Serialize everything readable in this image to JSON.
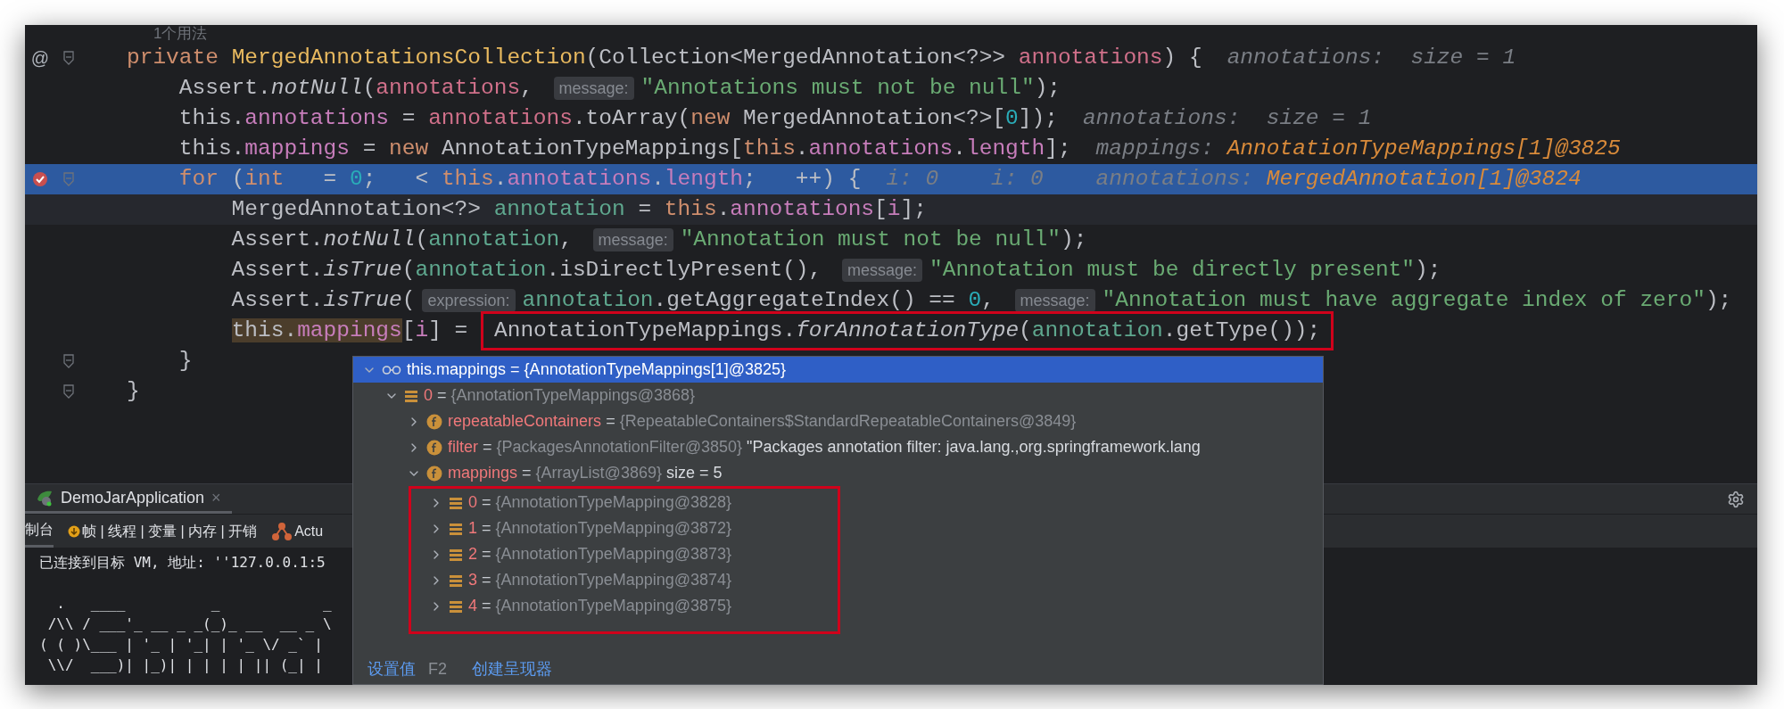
{
  "editor": {
    "lines": [
      {
        "kind": "usage",
        "text": "1个用法"
      },
      {
        "kind": "code",
        "marker": "@",
        "breakpoint": false,
        "fold": true,
        "tokens": [
          {
            "kind": "kw",
            "text": "private "
          },
          {
            "kind": "decl",
            "text": "MergedAnnotationsCollection"
          },
          {
            "kind": "plain",
            "text": "(Collection<MergedAnnotation<?>> "
          },
          {
            "kind": "param",
            "text": "annotations"
          },
          {
            "kind": "plain",
            "text": ") {"
          },
          {
            "kind": "value",
            "text": "annotations:  size = 1"
          }
        ]
      },
      {
        "kind": "code",
        "breakpoint": false,
        "fold": false,
        "tokens": [
          {
            "kind": "plain",
            "text": "    Assert."
          },
          {
            "kind": "italic",
            "text": "notNull"
          },
          {
            "kind": "plain",
            "text": "("
          },
          {
            "kind": "param",
            "text": "annotations"
          },
          {
            "kind": "plain",
            "text": ", "
          },
          {
            "kind": "hint",
            "text": "message:"
          },
          {
            "kind": "string",
            "text": "\"Annotations must not be null\""
          },
          {
            "kind": "plain",
            "text": ");"
          }
        ]
      },
      {
        "kind": "code",
        "breakpoint": false,
        "fold": false,
        "tokens": [
          {
            "kind": "plain",
            "text": "    this."
          },
          {
            "kind": "field",
            "text": "annotations"
          },
          {
            "kind": "plain",
            "text": " = "
          },
          {
            "kind": "param",
            "text": "annotations"
          },
          {
            "kind": "plain",
            "text": ".toArray("
          },
          {
            "kind": "kw",
            "text": "new "
          },
          {
            "kind": "plain",
            "text": "MergedAnnotation<?>["
          },
          {
            "kind": "num",
            "text": "0"
          },
          {
            "kind": "plain",
            "text": "]);"
          },
          {
            "kind": "value",
            "text": "annotations:  size = 1"
          }
        ]
      },
      {
        "kind": "code",
        "breakpoint": false,
        "fold": false,
        "tokens": [
          {
            "kind": "plain",
            "text": "    this."
          },
          {
            "kind": "field",
            "text": "mappings"
          },
          {
            "kind": "plain",
            "text": " = "
          },
          {
            "kind": "kw",
            "text": "new "
          },
          {
            "kind": "plain",
            "text": "AnnotationTypeMappings["
          },
          {
            "kind": "kw",
            "text": "this"
          },
          {
            "kind": "plain",
            "text": "."
          },
          {
            "kind": "field",
            "text": "annotations"
          },
          {
            "kind": "plain",
            "text": "."
          },
          {
            "kind": "field",
            "text": "length"
          },
          {
            "kind": "plain",
            "text": "];"
          },
          {
            "kind": "value",
            "text": "mappings: "
          },
          {
            "kind": "ref",
            "text": "AnnotationTypeMappings[1]@3825"
          }
        ]
      },
      {
        "kind": "current",
        "breakpoint": true,
        "fold": true,
        "tokens": [
          {
            "kind": "kw",
            "text": "    for "
          },
          {
            "kind": "plain",
            "text": "("
          },
          {
            "kind": "kw",
            "text": "int "
          },
          {
            "kind": "plain",
            "text": "  = "
          },
          {
            "kind": "num",
            "text": "0"
          },
          {
            "kind": "plain",
            "text": ";   < "
          },
          {
            "kind": "kw",
            "text": "this"
          },
          {
            "kind": "plain",
            "text": "."
          },
          {
            "kind": "field",
            "text": "annotations"
          },
          {
            "kind": "plain",
            "text": "."
          },
          {
            "kind": "field",
            "text": "length"
          },
          {
            "kind": "plain",
            "text": ";   ++) {"
          },
          {
            "kind": "value",
            "text": "i: 0    i: 0    annotations: "
          },
          {
            "kind": "ref",
            "text": "MergedAnnotation[1]@3824"
          }
        ]
      },
      {
        "kind": "caret",
        "breakpoint": false,
        "fold": false,
        "tokens": [
          {
            "kind": "plain",
            "text": "        MergedAnnotation<?> "
          },
          {
            "kind": "local",
            "text": "annotation"
          },
          {
            "kind": "plain",
            "text": " = "
          },
          {
            "kind": "kw",
            "text": "this"
          },
          {
            "kind": "plain",
            "text": "."
          },
          {
            "kind": "field",
            "text": "annotations"
          },
          {
            "kind": "plain",
            "text": "["
          },
          {
            "kind": "field",
            "text": "i"
          },
          {
            "kind": "plain",
            "text": "];"
          }
        ]
      },
      {
        "kind": "code",
        "breakpoint": false,
        "fold": false,
        "tokens": [
          {
            "kind": "plain",
            "text": "        Assert."
          },
          {
            "kind": "italic",
            "text": "notNull"
          },
          {
            "kind": "plain",
            "text": "("
          },
          {
            "kind": "local",
            "text": "annotation"
          },
          {
            "kind": "plain",
            "text": ", "
          },
          {
            "kind": "hint",
            "text": "message:"
          },
          {
            "kind": "string",
            "text": "\"Annotation must not be null\""
          },
          {
            "kind": "plain",
            "text": ");"
          }
        ]
      },
      {
        "kind": "code",
        "breakpoint": false,
        "fold": false,
        "tokens": [
          {
            "kind": "plain",
            "text": "        Assert."
          },
          {
            "kind": "italic",
            "text": "isTrue"
          },
          {
            "kind": "plain",
            "text": "("
          },
          {
            "kind": "local",
            "text": "annotation"
          },
          {
            "kind": "plain",
            "text": ".isDirectlyPresent(), "
          },
          {
            "kind": "hint",
            "text": "message:"
          },
          {
            "kind": "string",
            "text": "\"Annotation must be directly present\""
          },
          {
            "kind": "plain",
            "text": ");"
          }
        ]
      },
      {
        "kind": "code",
        "breakpoint": false,
        "fold": false,
        "tokens": [
          {
            "kind": "plain",
            "text": "        Assert."
          },
          {
            "kind": "italic",
            "text": "isTrue"
          },
          {
            "kind": "plain",
            "text": "("
          },
          {
            "kind": "hint",
            "text": "expression:"
          },
          {
            "kind": "local",
            "text": "annotation"
          },
          {
            "kind": "plain",
            "text": ".getAggregateIndex() == "
          },
          {
            "kind": "num",
            "text": "0"
          },
          {
            "kind": "plain",
            "text": ", "
          },
          {
            "kind": "hint",
            "text": "message:"
          },
          {
            "kind": "string",
            "text": "\"Annotation must have aggregate index of zero\""
          },
          {
            "kind": "plain",
            "text": ");"
          }
        ]
      },
      {
        "kind": "code",
        "breakpoint": false,
        "fold": false,
        "tokens": [
          {
            "kind": "hl_plain",
            "text": "        this."
          },
          {
            "kind": "hl_field",
            "text": "mappings"
          },
          {
            "kind": "plain",
            "text": "["
          },
          {
            "kind": "field",
            "text": "i"
          },
          {
            "kind": "plain",
            "text": "] = "
          },
          {
            "kind": "group",
            "framed": true,
            "tokens": [
              {
                "kind": "plain",
                "text": "AnnotationTypeMappings."
              },
              {
                "kind": "italic",
                "text": "forAnnotationType"
              },
              {
                "kind": "plain",
                "text": "("
              },
              {
                "kind": "local",
                "text": "annotation"
              },
              {
                "kind": "plain",
                "text": ".getType());"
              }
            ]
          }
        ]
      },
      {
        "kind": "code",
        "breakpoint": false,
        "fold": true,
        "tokens": [
          {
            "kind": "plain",
            "text": "    }"
          }
        ]
      },
      {
        "kind": "code",
        "breakpoint": false,
        "fold": true,
        "tokens": [
          {
            "kind": "plain",
            "text": "}"
          }
        ]
      }
    ]
  },
  "debug_popup": {
    "tree": {
      "kind": "watch",
      "name": "this.mappings",
      "sign": "=",
      "value": "{AnnotationTypeMappings[1]@3825}",
      "expanded": true,
      "selected": true,
      "children": [
        {
          "kind": "array",
          "name": "0",
          "sign": "=",
          "value": "{AnnotationTypeMappings@3868}",
          "expanded": true,
          "selected": false,
          "children": [
            {
              "kind": "field",
              "name": "repeatableContainers",
              "sign": "=",
              "value": "{RepeatableContainers$StandardRepeatableContainers@3849}",
              "expanded": false,
              "selected": false
            },
            {
              "kind": "field",
              "name": "filter",
              "sign": "=",
              "value": "{PackagesAnnotationFilter@3850}",
              "description": "\"Packages annotation filter: java.lang.,org.springframework.lang",
              "expanded": false,
              "selected": false
            },
            {
              "kind": "field",
              "name": "mappings",
              "sign": "=",
              "value": "{ArrayList@3869}",
              "description": "size = 5",
              "expanded": true,
              "selected": false,
              "framed": true,
              "children": [
                {
                  "kind": "array",
                  "name": "0",
                  "sign": "=",
                  "value": "{AnnotationTypeMapping@3828}",
                  "expanded": false,
                  "selected": false
                },
                {
                  "kind": "array",
                  "name": "1",
                  "sign": "=",
                  "value": "{AnnotationTypeMapping@3872}",
                  "expanded": false,
                  "selected": false
                },
                {
                  "kind": "array",
                  "name": "2",
                  "sign": "=",
                  "value": "{AnnotationTypeMapping@3873}",
                  "expanded": false,
                  "selected": false
                },
                {
                  "kind": "array",
                  "name": "3",
                  "sign": "=",
                  "value": "{AnnotationTypeMapping@3874}",
                  "expanded": false,
                  "selected": false
                },
                {
                  "kind": "array",
                  "name": "4",
                  "sign": "=",
                  "value": "{AnnotationTypeMapping@3875}",
                  "expanded": false,
                  "selected": false
                }
              ]
            }
          ]
        }
      ]
    },
    "actions": [
      {
        "label": "设置值",
        "shortcut": "F2"
      },
      {
        "label": "创建呈现器"
      }
    ]
  },
  "run_panel": {
    "tab": {
      "label": "DemoJarApplication",
      "close": "×",
      "selected": true
    },
    "toolbar": [
      {
        "kind": "plain",
        "label": "制台",
        "selected": true
      },
      {
        "kind": "debug",
        "label": "帧 | 线程 | 变量 | 内存 | 开销",
        "selected": false
      },
      {
        "kind": "actuator",
        "label": "Actu",
        "selected": false
      }
    ],
    "console": {
      "status": "已连接到目标 VM, 地址: ''127.0.0.1:5",
      "banner": [
        "  .   ____          _            _",
        " /\\\\ / ___'_ __ _ _(_)_ __  __ _ \\",
        "( ( )\\___ | '_ | '_| | '_ \\/ _` |",
        " \\\\/  ___)| |_)| | | | | || (_| |"
      ]
    }
  }
}
